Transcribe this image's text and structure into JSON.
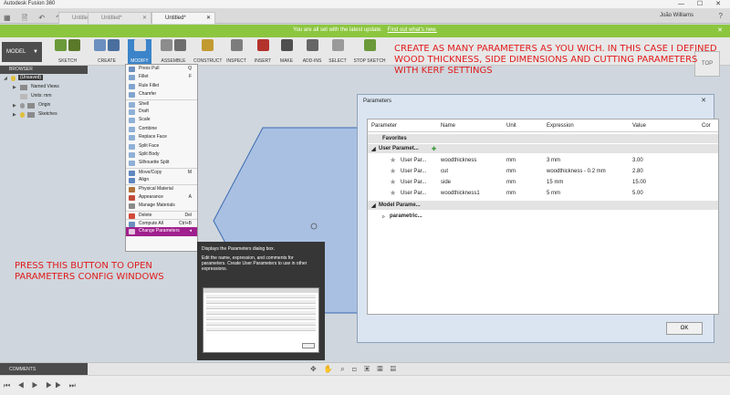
{
  "window": {
    "title": "Autodesk Fusion 360",
    "controls": "— ☐ ✕"
  },
  "tabs": [
    {
      "label": "Untitled*"
    },
    {
      "label": "Untitled*"
    },
    {
      "label": "Untitled*"
    }
  ],
  "user": "João Williams",
  "banner": {
    "text": "You are all set with the latest update.",
    "link": "Find out what's new."
  },
  "toolbar": {
    "workspace": "MODEL",
    "groups": [
      "SKETCH",
      "CREATE",
      "MODIFY",
      "ASSEMBLE",
      "CONSTRUCT",
      "INSPECT",
      "INSERT",
      "MAKE",
      "ADD-INS",
      "SELECT",
      "STOP SKETCH"
    ],
    "accent": "#3b84c9"
  },
  "browser": {
    "header": "BROWSER",
    "items": [
      {
        "label": "(Unsaved)"
      },
      {
        "label": "Named Views"
      },
      {
        "label": "Units: mm"
      },
      {
        "label": "Origin"
      },
      {
        "label": "Sketches"
      }
    ]
  },
  "viewcube": "TOP",
  "modify_menu": {
    "items": [
      {
        "label": "Press Pull",
        "key": "Q"
      },
      {
        "label": "Fillet",
        "key": "F"
      },
      {
        "label": "Rule Fillet",
        "key": ""
      },
      {
        "label": "Chamfer",
        "key": ""
      },
      {
        "label": "Shell",
        "key": ""
      },
      {
        "label": "Draft",
        "key": ""
      },
      {
        "label": "Scale",
        "key": ""
      },
      {
        "label": "Combine",
        "key": ""
      },
      {
        "label": "Replace Face",
        "key": ""
      },
      {
        "label": "Split Face",
        "key": ""
      },
      {
        "label": "Split Body",
        "key": ""
      },
      {
        "label": "Silhouette Split",
        "key": ""
      },
      {
        "label": "Move/Copy",
        "key": "M"
      },
      {
        "label": "Align",
        "key": ""
      },
      {
        "label": "Physical Material",
        "key": ""
      },
      {
        "label": "Appearance",
        "key": "A"
      },
      {
        "label": "Manage Materials",
        "key": ""
      },
      {
        "label": "Delete",
        "key": "Del"
      },
      {
        "label": "Compute All",
        "key": "Ctrl+B"
      },
      {
        "label": "Change Parameters",
        "key": ""
      }
    ],
    "highlight_color": "#a0208d"
  },
  "tooltip": {
    "title": "Displays the Parameters dialog box.",
    "body": "Edit the name, expression, and comments for parameters. Create User Parameters to use in other expressions."
  },
  "annotations": {
    "top": "CREATE AS MANY PARAMETERS AS YOU WICH. IN THIS CASE I DEFINED WOOD THICKNESS, SIDE DIMENSIONS AND CUTTING PARAMETERS WITH KERF SETTINGS",
    "bottom": "PRESS THIS BUTTON TO OPEN PARAMETERS CONFIG WINDOWS",
    "color": "#e11b1b"
  },
  "dialog": {
    "title": "Parameters",
    "close": "✕",
    "columns": [
      "Parameter",
      "Name",
      "Unit",
      "Expression",
      "Value",
      "Cor"
    ],
    "group_favorites": "Favorites",
    "group_user": "User Paramet...",
    "rows": [
      {
        "parameter": "User Par...",
        "name": "woodthickness",
        "unit": "mm",
        "expression": "3 mm",
        "value": "3.00"
      },
      {
        "parameter": "User Par...",
        "name": "cut",
        "unit": "mm",
        "expression": "woodthickness - 0.2 mm",
        "value": "2.80"
      },
      {
        "parameter": "User Par...",
        "name": "side",
        "unit": "mm",
        "expression": "15 mm",
        "value": "15.00"
      },
      {
        "parameter": "User Par...",
        "name": "woodthickness1",
        "unit": "mm",
        "expression": "5 mm",
        "value": "5.00"
      }
    ],
    "group_model": "Model Parame...",
    "model_child": "parametric...",
    "ok": "OK"
  },
  "statusbar": {
    "comments": "COMMENTS"
  }
}
